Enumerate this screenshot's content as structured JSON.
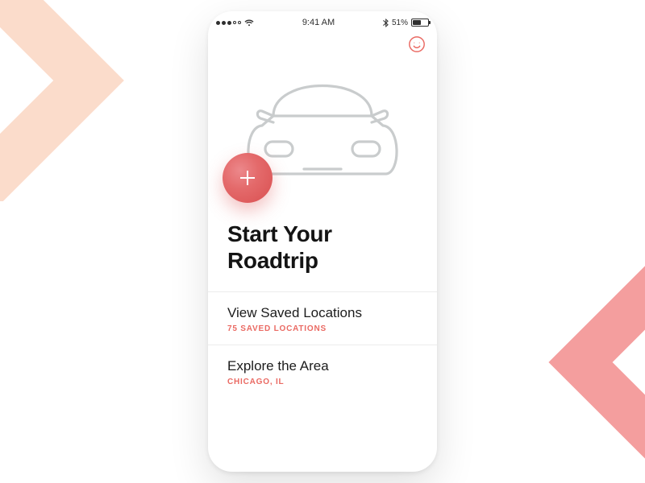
{
  "status": {
    "time": "9:41 AM",
    "battery_percent_text": "51%",
    "battery_fill_pct": 51
  },
  "colors": {
    "accent": "#ea6a63",
    "chevron_peach": "#fbdccb",
    "chevron_pink": "#f49e9e",
    "line_gray": "#c9cccd"
  },
  "headline": "Start Your Roadtrip",
  "rows": [
    {
      "title": "View Saved Locations",
      "sub": "75 SAVED LOCATIONS"
    },
    {
      "title": "Explore the Area",
      "sub": "CHICAGO, IL"
    }
  ]
}
